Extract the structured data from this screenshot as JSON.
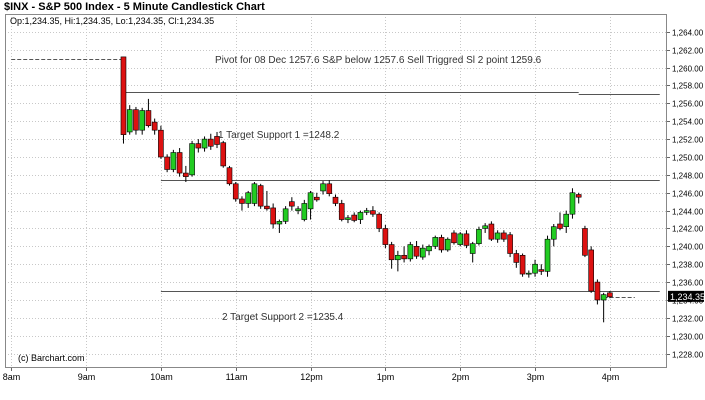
{
  "title": "$INX - S&P 500 Index - 5 Minute Candlestick Chart",
  "ohlc_label": "Op:1,234.35, Hi:1,234.35, Lo:1,234.35, Cl:1,234.35",
  "copyright": "(c) Barchart.com",
  "colors": {
    "up": "#22cc22",
    "down": "#dd1111",
    "grid": "#c8c8c8",
    "plotbg": "#ffffff"
  },
  "annotations": [
    "Pivot for 08 Dec 1257.6 S&P below 1257.6 Sell Triggred Sl 2  point 1259.6",
    "1 Target Support 1 =1248.2",
    "2 Target Support 2 =1235.4"
  ],
  "last_price": "1,234.35",
  "chart_data": {
    "type": "candlestick",
    "title": "$INX - S&P 500 Index - 5 Minute Candlestick Chart",
    "interval": "5 minute",
    "ylim": [
      1226.5,
      1266
    ],
    "y_ticks": [
      "1,228.00",
      "1,230.00",
      "1,232.00",
      "1,234.00",
      "1,236.00",
      "1,238.00",
      "1,240.00",
      "1,242.00",
      "1,244.00",
      "1,246.00",
      "1,248.00",
      "1,250.00",
      "1,252.00",
      "1,254.00",
      "1,256.00",
      "1,258.00",
      "1,260.00",
      "1,262.00",
      "1,264.00"
    ],
    "x_ticks": [
      "8am",
      "9am",
      "10am",
      "11am",
      "12pm",
      "1pm",
      "2pm",
      "3pm",
      "4pm"
    ],
    "grid": true,
    "levels": [
      {
        "value": 1261.0,
        "from": "8:00",
        "to": "9:30",
        "style": "dashed"
      },
      {
        "value": 1257.3,
        "from": "9:30",
        "to": "15:35",
        "style": "solid"
      },
      {
        "value": 1257.1,
        "from": "15:35",
        "to": "16:40",
        "style": "solid"
      },
      {
        "value": 1247.4,
        "from": "10:00",
        "to": "16:40",
        "style": "solid"
      },
      {
        "value": 1235.0,
        "from": "10:00",
        "to": "16:40",
        "style": "solid"
      },
      {
        "value": 1234.35,
        "from": "15:55",
        "to": "16:20",
        "style": "dashed"
      }
    ],
    "candles": [
      {
        "t": "9:30",
        "o": 1261.2,
        "h": 1261.2,
        "l": 1251.5,
        "c": 1252.5
      },
      {
        "t": "9:35",
        "o": 1252.8,
        "h": 1255.8,
        "l": 1252.5,
        "c": 1255.3
      },
      {
        "t": "9:40",
        "o": 1255.3,
        "h": 1255.6,
        "l": 1252.5,
        "c": 1253.0
      },
      {
        "t": "9:45",
        "o": 1253.0,
        "h": 1255.5,
        "l": 1252.5,
        "c": 1255.2
      },
      {
        "t": "9:50",
        "o": 1255.2,
        "h": 1256.5,
        "l": 1253.3,
        "c": 1253.5
      },
      {
        "t": "9:55",
        "o": 1253.9,
        "h": 1254.3,
        "l": 1252.5,
        "c": 1253.0
      },
      {
        "t": "10:00",
        "o": 1253.0,
        "h": 1253.5,
        "l": 1249.8,
        "c": 1250.0
      },
      {
        "t": "10:05",
        "o": 1250.0,
        "h": 1250.3,
        "l": 1248.3,
        "c": 1248.6
      },
      {
        "t": "10:10",
        "o": 1248.6,
        "h": 1250.8,
        "l": 1248.3,
        "c": 1250.5
      },
      {
        "t": "10:15",
        "o": 1250.5,
        "h": 1251.0,
        "l": 1247.8,
        "c": 1248.2
      },
      {
        "t": "10:20",
        "o": 1248.2,
        "h": 1249.0,
        "l": 1247.2,
        "c": 1247.8
      },
      {
        "t": "10:25",
        "o": 1248.0,
        "h": 1251.8,
        "l": 1247.8,
        "c": 1251.5
      },
      {
        "t": "10:30",
        "o": 1251.5,
        "h": 1252.0,
        "l": 1250.5,
        "c": 1251.0
      },
      {
        "t": "10:35",
        "o": 1251.0,
        "h": 1252.3,
        "l": 1250.6,
        "c": 1252.0
      },
      {
        "t": "10:40",
        "o": 1252.0,
        "h": 1252.6,
        "l": 1250.8,
        "c": 1251.2
      },
      {
        "t": "10:45",
        "o": 1252.3,
        "h": 1252.8,
        "l": 1251.0,
        "c": 1251.4
      },
      {
        "t": "10:50",
        "o": 1251.6,
        "h": 1251.8,
        "l": 1248.8,
        "c": 1249.0
      },
      {
        "t": "10:55",
        "o": 1248.8,
        "h": 1249.0,
        "l": 1246.8,
        "c": 1247.0
      },
      {
        "t": "11:00",
        "o": 1247.0,
        "h": 1247.2,
        "l": 1245.0,
        "c": 1245.3
      },
      {
        "t": "11:05",
        "o": 1245.3,
        "h": 1245.6,
        "l": 1244.0,
        "c": 1244.8
      },
      {
        "t": "11:10",
        "o": 1244.8,
        "h": 1246.2,
        "l": 1244.3,
        "c": 1246.0
      },
      {
        "t": "11:15",
        "o": 1244.8,
        "h": 1247.2,
        "l": 1244.5,
        "c": 1247.0
      },
      {
        "t": "11:20",
        "o": 1246.8,
        "h": 1247.0,
        "l": 1244.2,
        "c": 1244.5
      },
      {
        "t": "11:25",
        "o": 1244.5,
        "h": 1246.2,
        "l": 1244.0,
        "c": 1244.2
      },
      {
        "t": "11:30",
        "o": 1244.3,
        "h": 1244.8,
        "l": 1242.0,
        "c": 1242.5
      },
      {
        "t": "11:35",
        "o": 1242.5,
        "h": 1243.0,
        "l": 1241.5,
        "c": 1242.8
      },
      {
        "t": "11:40",
        "o": 1242.8,
        "h": 1244.5,
        "l": 1242.5,
        "c": 1244.2
      },
      {
        "t": "11:45",
        "o": 1245.0,
        "h": 1245.5,
        "l": 1244.0,
        "c": 1244.5
      },
      {
        "t": "11:50",
        "o": 1244.0,
        "h": 1244.5,
        "l": 1243.6,
        "c": 1244.2
      },
      {
        "t": "11:55",
        "o": 1243.0,
        "h": 1245.2,
        "l": 1242.8,
        "c": 1244.8
      },
      {
        "t": "12:00",
        "o": 1244.2,
        "h": 1246.2,
        "l": 1243.0,
        "c": 1246.0
      },
      {
        "t": "12:05",
        "o": 1245.5,
        "h": 1246.0,
        "l": 1245.0,
        "c": 1245.2
      },
      {
        "t": "12:10",
        "o": 1246.2,
        "h": 1247.3,
        "l": 1245.8,
        "c": 1247.0
      },
      {
        "t": "12:15",
        "o": 1247.0,
        "h": 1247.4,
        "l": 1245.6,
        "c": 1245.9
      },
      {
        "t": "12:20",
        "o": 1245.5,
        "h": 1245.8,
        "l": 1244.5,
        "c": 1244.8
      },
      {
        "t": "12:25",
        "o": 1244.8,
        "h": 1245.2,
        "l": 1242.8,
        "c": 1243.0
      },
      {
        "t": "12:30",
        "o": 1243.0,
        "h": 1243.5,
        "l": 1242.6,
        "c": 1243.2
      },
      {
        "t": "12:35",
        "o": 1243.5,
        "h": 1243.8,
        "l": 1242.7,
        "c": 1242.9
      },
      {
        "t": "12:40",
        "o": 1243.0,
        "h": 1244.0,
        "l": 1242.5,
        "c": 1243.8
      },
      {
        "t": "12:45",
        "o": 1243.8,
        "h": 1244.3,
        "l": 1243.5,
        "c": 1244.0
      },
      {
        "t": "12:50",
        "o": 1244.0,
        "h": 1244.5,
        "l": 1243.3,
        "c": 1243.6
      },
      {
        "t": "12:55",
        "o": 1243.6,
        "h": 1243.8,
        "l": 1241.6,
        "c": 1242.0
      },
      {
        "t": "13:00",
        "o": 1242.0,
        "h": 1242.4,
        "l": 1239.8,
        "c": 1240.2
      },
      {
        "t": "13:05",
        "o": 1240.2,
        "h": 1240.5,
        "l": 1237.5,
        "c": 1238.5
      },
      {
        "t": "13:10",
        "o": 1238.5,
        "h": 1239.5,
        "l": 1237.2,
        "c": 1239.0
      },
      {
        "t": "13:15",
        "o": 1239.0,
        "h": 1240.0,
        "l": 1238.2,
        "c": 1238.6
      },
      {
        "t": "13:20",
        "o": 1238.6,
        "h": 1240.5,
        "l": 1238.3,
        "c": 1240.2
      },
      {
        "t": "13:25",
        "o": 1240.0,
        "h": 1240.6,
        "l": 1238.6,
        "c": 1238.9
      },
      {
        "t": "13:30",
        "o": 1238.8,
        "h": 1240.2,
        "l": 1238.5,
        "c": 1239.8
      },
      {
        "t": "13:35",
        "o": 1239.5,
        "h": 1240.2,
        "l": 1239.0,
        "c": 1240.0
      },
      {
        "t": "13:40",
        "o": 1240.0,
        "h": 1241.2,
        "l": 1239.7,
        "c": 1241.0
      },
      {
        "t": "13:45",
        "o": 1241.0,
        "h": 1241.3,
        "l": 1239.3,
        "c": 1239.6
      },
      {
        "t": "13:50",
        "o": 1239.6,
        "h": 1241.0,
        "l": 1239.4,
        "c": 1240.8
      },
      {
        "t": "13:55",
        "o": 1241.5,
        "h": 1241.8,
        "l": 1240.2,
        "c": 1240.4
      },
      {
        "t": "14:00",
        "o": 1240.2,
        "h": 1241.6,
        "l": 1240.0,
        "c": 1241.4
      },
      {
        "t": "14:05",
        "o": 1241.4,
        "h": 1241.8,
        "l": 1239.8,
        "c": 1240.1
      },
      {
        "t": "14:10",
        "o": 1239.2,
        "h": 1240.5,
        "l": 1238.2,
        "c": 1240.3
      },
      {
        "t": "14:15",
        "o": 1240.3,
        "h": 1242.2,
        "l": 1240.1,
        "c": 1241.9
      },
      {
        "t": "14:20",
        "o": 1242.0,
        "h": 1242.6,
        "l": 1241.5,
        "c": 1242.3
      },
      {
        "t": "14:25",
        "o": 1242.5,
        "h": 1242.8,
        "l": 1240.6,
        "c": 1240.8
      },
      {
        "t": "14:30",
        "o": 1240.8,
        "h": 1241.8,
        "l": 1240.4,
        "c": 1241.5
      },
      {
        "t": "14:35",
        "o": 1241.5,
        "h": 1241.8,
        "l": 1240.5,
        "c": 1240.8
      },
      {
        "t": "14:40",
        "o": 1241.3,
        "h": 1241.6,
        "l": 1238.8,
        "c": 1239.2
      },
      {
        "t": "14:45",
        "o": 1239.2,
        "h": 1239.6,
        "l": 1237.6,
        "c": 1238.2
      },
      {
        "t": "14:50",
        "o": 1239.0,
        "h": 1239.2,
        "l": 1236.6,
        "c": 1236.9
      },
      {
        "t": "14:55",
        "o": 1236.9,
        "h": 1237.3,
        "l": 1236.5,
        "c": 1237.0
      },
      {
        "t": "15:00",
        "o": 1237.0,
        "h": 1238.5,
        "l": 1236.6,
        "c": 1238.0
      },
      {
        "t": "15:05",
        "o": 1237.4,
        "h": 1238.0,
        "l": 1236.8,
        "c": 1237.2
      },
      {
        "t": "15:10",
        "o": 1237.2,
        "h": 1241.2,
        "l": 1236.6,
        "c": 1240.8
      },
      {
        "t": "15:15",
        "o": 1240.8,
        "h": 1242.5,
        "l": 1240.0,
        "c": 1242.2
      },
      {
        "t": "15:20",
        "o": 1242.5,
        "h": 1243.8,
        "l": 1241.8,
        "c": 1242.0
      },
      {
        "t": "15:25",
        "o": 1242.2,
        "h": 1244.0,
        "l": 1241.5,
        "c": 1243.6
      },
      {
        "t": "15:30",
        "o": 1243.6,
        "h": 1246.5,
        "l": 1243.1,
        "c": 1246.0
      },
      {
        "t": "15:35",
        "o": 1245.8,
        "h": 1246.0,
        "l": 1244.8,
        "c": 1245.5
      },
      {
        "t": "15:40",
        "o": 1242.0,
        "h": 1242.3,
        "l": 1238.8,
        "c": 1239.0
      },
      {
        "t": "15:45",
        "o": 1239.6,
        "h": 1240.0,
        "l": 1234.8,
        "c": 1235.0
      },
      {
        "t": "15:50",
        "o": 1236.0,
        "h": 1236.3,
        "l": 1233.5,
        "c": 1234.0
      },
      {
        "t": "15:55",
        "o": 1234.0,
        "h": 1234.8,
        "l": 1231.5,
        "c": 1234.6
      },
      {
        "t": "16:00",
        "o": 1234.8,
        "h": 1235.0,
        "l": 1234.2,
        "c": 1234.35
      }
    ]
  }
}
